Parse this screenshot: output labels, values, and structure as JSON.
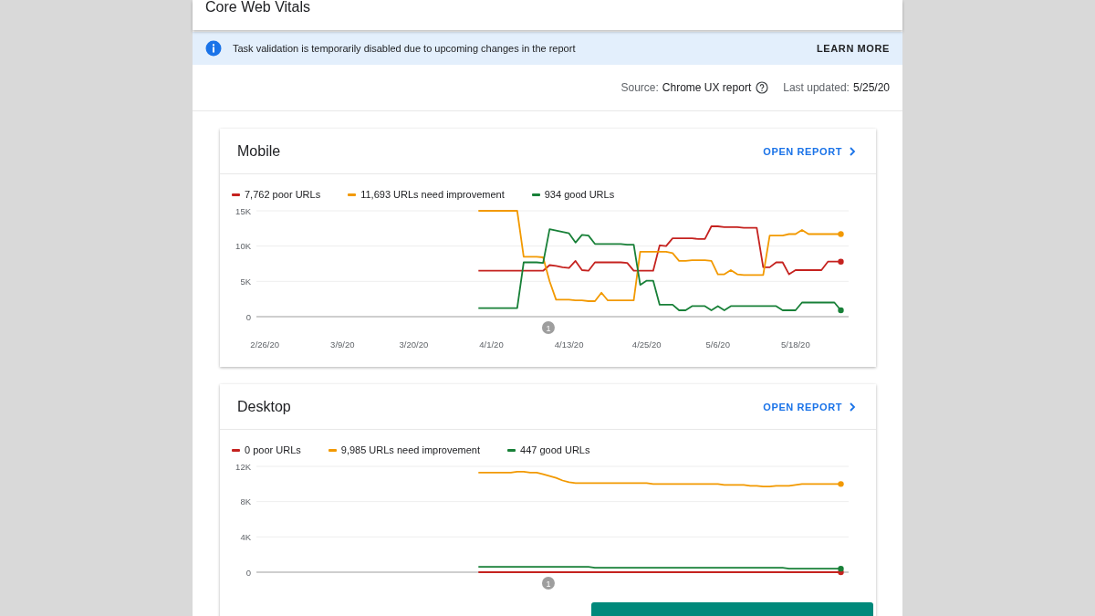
{
  "page_title": "Core Web Vitals",
  "banner": {
    "message": "Task validation is temporarily disabled due to upcoming changes in the report",
    "action": "LEARN MORE"
  },
  "source": {
    "label": "Source:",
    "value": "Chrome UX report",
    "updated_label": "Last updated:",
    "updated_value": "5/25/20"
  },
  "cards": [
    {
      "title": "Mobile",
      "link": "OPEN REPORT",
      "chart_data": {
        "type": "line",
        "categories": [
          "2/26/20",
          null,
          null,
          null,
          null,
          null,
          null,
          null,
          null,
          null,
          null,
          null,
          "3/9/20",
          null,
          null,
          null,
          null,
          null,
          null,
          null,
          null,
          null,
          null,
          "3/20/20",
          null,
          null,
          null,
          null,
          null,
          null,
          null,
          null,
          null,
          null,
          null,
          "4/1/20",
          null,
          null,
          null,
          null,
          null,
          null,
          null,
          null,
          null,
          null,
          null,
          "4/13/20",
          null,
          null,
          null,
          null,
          null,
          null,
          null,
          null,
          null,
          null,
          null,
          "4/25/20",
          null,
          null,
          null,
          null,
          null,
          null,
          null,
          null,
          null,
          null,
          "5/6/20",
          null,
          null,
          null,
          null,
          null,
          null,
          null,
          null,
          null,
          null,
          null,
          "5/18/20",
          null,
          null,
          null,
          null,
          null,
          null,
          null
        ],
        "ylim": [
          0,
          15000
        ],
        "yticks": [
          {
            "value": 0,
            "label": "0"
          },
          {
            "value": 5000,
            "label": "5K"
          },
          {
            "value": 10000,
            "label": "10K"
          },
          {
            "value": 15000,
            "label": "15K"
          }
        ],
        "annotations": [
          "1"
        ],
        "series": [
          {
            "name": "7,762 poor URLs",
            "color": "#c5221f",
            "values": [
              null,
              null,
              null,
              null,
              null,
              null,
              null,
              null,
              null,
              null,
              null,
              null,
              null,
              null,
              null,
              null,
              null,
              null,
              null,
              null,
              null,
              null,
              null,
              null,
              null,
              null,
              null,
              null,
              null,
              null,
              null,
              null,
              null,
              6500,
              6500,
              6500,
              6500,
              6500,
              6500,
              6500,
              6500,
              6500,
              6500,
              6500,
              7300,
              7200,
              7000,
              6900,
              7900,
              6600,
              6500,
              7700,
              7700,
              7700,
              7700,
              7700,
              7600,
              6500,
              6500,
              6500,
              6500,
              10100,
              10000,
              11100,
              11100,
              11100,
              11100,
              11000,
              11000,
              12800,
              12800,
              12700,
              12700,
              12700,
              12600,
              12600,
              12600,
              7000,
              7000,
              7700,
              7700,
              6000,
              6600,
              6600,
              6600,
              6600,
              6600,
              7800,
              7800,
              7800
            ]
          },
          {
            "name": "11,693 URLs need improvement",
            "color": "#f29900",
            "values": [
              null,
              null,
              null,
              null,
              null,
              null,
              null,
              null,
              null,
              null,
              null,
              null,
              null,
              null,
              null,
              null,
              null,
              null,
              null,
              null,
              null,
              null,
              null,
              null,
              null,
              null,
              null,
              null,
              null,
              null,
              null,
              null,
              null,
              15000,
              15000,
              15000,
              15000,
              15000,
              15000,
              15000,
              8500,
              8500,
              8500,
              8400,
              5000,
              2400,
              2400,
              2400,
              2300,
              2300,
              2200,
              2200,
              3400,
              2300,
              2300,
              2300,
              2300,
              2300,
              9200,
              9200,
              9200,
              9200,
              9200,
              9000,
              7900,
              7900,
              8000,
              8000,
              8000,
              7900,
              6000,
              6000,
              6600,
              6000,
              5900,
              5900,
              5900,
              5900,
              11500,
              11500,
              11500,
              11700,
              11700,
              12300,
              11700,
              11700,
              11700,
              11700,
              11700,
              11700
            ]
          },
          {
            "name": "934 good URLs",
            "color": "#188038",
            "values": [
              null,
              null,
              null,
              null,
              null,
              null,
              null,
              null,
              null,
              null,
              null,
              null,
              null,
              null,
              null,
              null,
              null,
              null,
              null,
              null,
              null,
              null,
              null,
              null,
              null,
              null,
              null,
              null,
              null,
              null,
              null,
              null,
              null,
              1200,
              1200,
              1200,
              1200,
              1200,
              1200,
              1200,
              7700,
              7700,
              7700,
              7600,
              12400,
              12200,
              12000,
              11800,
              10500,
              11600,
              11500,
              10300,
              10300,
              10300,
              10300,
              10300,
              10200,
              10200,
              4500,
              5100,
              5100,
              1700,
              1700,
              1700,
              900,
              900,
              1500,
              1500,
              1500,
              900,
              1500,
              900,
              1500,
              1500,
              1500,
              1500,
              1500,
              1500,
              1500,
              1500,
              900,
              900,
              900,
              2000,
              2000,
              2000,
              2000,
              2000,
              2000,
              900
            ]
          }
        ]
      }
    },
    {
      "title": "Desktop",
      "link": "OPEN REPORT",
      "chart_data": {
        "type": "line",
        "categories": [
          null,
          null,
          null,
          null,
          null,
          null,
          null,
          null,
          null,
          null,
          null,
          null,
          null,
          null,
          null,
          null,
          null,
          null,
          null,
          null,
          null,
          null,
          null,
          null,
          null,
          null,
          null,
          null,
          null,
          null,
          null,
          null,
          null,
          null,
          null,
          null,
          null,
          null,
          null,
          null,
          null,
          null,
          null,
          null,
          null,
          null,
          null,
          null,
          null,
          null,
          null,
          null,
          null,
          null,
          null,
          null,
          null,
          null,
          null,
          null,
          null,
          null,
          null,
          null,
          null,
          null,
          null,
          null,
          null,
          null,
          null,
          null,
          null,
          null,
          null,
          null,
          null,
          null,
          null,
          null,
          null,
          null,
          null,
          null,
          null,
          null,
          null,
          null,
          null,
          null
        ],
        "ylim": [
          0,
          12000
        ],
        "yticks": [
          {
            "value": 0,
            "label": "0"
          },
          {
            "value": 4000,
            "label": "4K"
          },
          {
            "value": 8000,
            "label": "8K"
          },
          {
            "value": 12000,
            "label": "12K"
          }
        ],
        "annotations": [
          "1"
        ],
        "series": [
          {
            "name": "0 poor URLs",
            "color": "#c5221f",
            "values": [
              null,
              null,
              null,
              null,
              null,
              null,
              null,
              null,
              null,
              null,
              null,
              null,
              null,
              null,
              null,
              null,
              null,
              null,
              null,
              null,
              null,
              null,
              null,
              null,
              null,
              null,
              null,
              null,
              null,
              null,
              null,
              null,
              null,
              0,
              0,
              0,
              0,
              0,
              0,
              0,
              0,
              0,
              0,
              0,
              0,
              0,
              0,
              0,
              0,
              0,
              0,
              0,
              0,
              0,
              0,
              0,
              0,
              0,
              0,
              0,
              0,
              0,
              0,
              0,
              0,
              0,
              0,
              0,
              0,
              0,
              0,
              0,
              0,
              0,
              0,
              0,
              0,
              0,
              0,
              0,
              0,
              0,
              0,
              0,
              0,
              0,
              0,
              0,
              0,
              0
            ]
          },
          {
            "name": "9,985 URLs need improvement",
            "color": "#f29900",
            "values": [
              null,
              null,
              null,
              null,
              null,
              null,
              null,
              null,
              null,
              null,
              null,
              null,
              null,
              null,
              null,
              null,
              null,
              null,
              null,
              null,
              null,
              null,
              null,
              null,
              null,
              null,
              null,
              null,
              null,
              null,
              null,
              null,
              null,
              11300,
              11300,
              11300,
              11300,
              11300,
              11300,
              11400,
              11400,
              11300,
              11300,
              11100,
              10900,
              10700,
              10400,
              10200,
              10100,
              10100,
              10100,
              10100,
              10100,
              10100,
              10100,
              10100,
              10100,
              10100,
              10100,
              10100,
              10000,
              10000,
              10000,
              10000,
              10000,
              10000,
              10000,
              10000,
              10000,
              10000,
              10000,
              9900,
              9900,
              9900,
              9900,
              9800,
              9800,
              9700,
              9700,
              9800,
              9800,
              9800,
              9900,
              10000,
              10000,
              10000,
              10000,
              10000,
              10000,
              10000
            ]
          },
          {
            "name": "447 good URLs",
            "color": "#188038",
            "values": [
              null,
              null,
              null,
              null,
              null,
              null,
              null,
              null,
              null,
              null,
              null,
              null,
              null,
              null,
              null,
              null,
              null,
              null,
              null,
              null,
              null,
              null,
              null,
              null,
              null,
              null,
              null,
              null,
              null,
              null,
              null,
              null,
              null,
              600,
              600,
              600,
              600,
              600,
              600,
              600,
              600,
              600,
              600,
              600,
              600,
              600,
              600,
              600,
              600,
              600,
              600,
              500,
              500,
              500,
              500,
              500,
              500,
              500,
              500,
              500,
              500,
              500,
              500,
              500,
              500,
              500,
              500,
              500,
              500,
              500,
              500,
              500,
              500,
              500,
              500,
              500,
              500,
              500,
              500,
              500,
              500,
              400,
              400,
              400,
              400,
              400,
              400,
              400,
              400,
              400
            ]
          }
        ]
      }
    }
  ]
}
